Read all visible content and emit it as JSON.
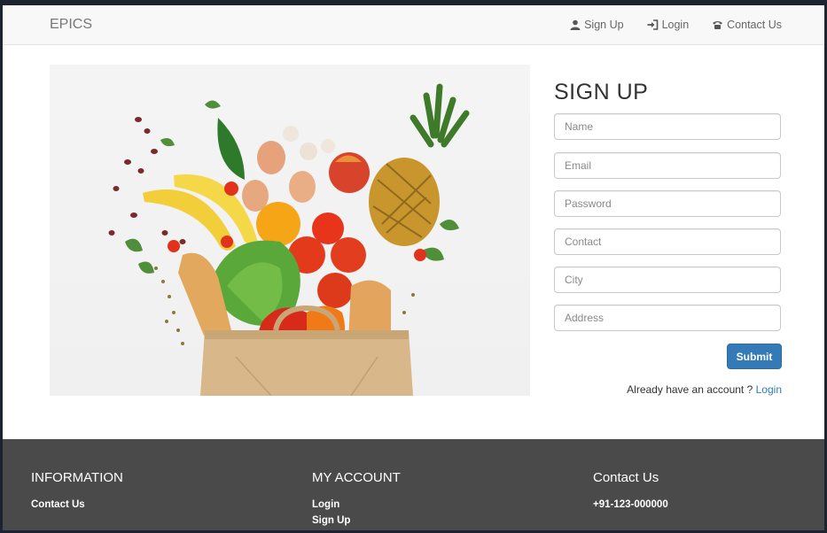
{
  "navbar": {
    "brand": "EPICS",
    "links": [
      {
        "label": "Sign Up",
        "icon": "user-icon"
      },
      {
        "label": "Login",
        "icon": "login-icon"
      },
      {
        "label": "Contact Us",
        "icon": "phone-icon"
      }
    ]
  },
  "hero": {
    "image": "grocery-bag-with-fruits-and-vegetables"
  },
  "form": {
    "title": "SIGN UP",
    "fields": [
      {
        "placeholder": "Name"
      },
      {
        "placeholder": "Email"
      },
      {
        "placeholder": "Password"
      },
      {
        "placeholder": "Contact"
      },
      {
        "placeholder": "City"
      },
      {
        "placeholder": "Address"
      }
    ],
    "submit_label": "Submit",
    "already_text": "Already have an account ?",
    "login_link": "Login"
  },
  "footer": {
    "information": {
      "title": "INFORMATION",
      "links": [
        "Contact Us"
      ]
    },
    "my_account": {
      "title": "MY ACCOUNT",
      "links": [
        "Login",
        "Sign Up"
      ]
    },
    "contact": {
      "title": "Contact Us",
      "phone": "+91-123-000000"
    }
  },
  "colors": {
    "accent": "#337ab7",
    "footer_bg": "#4a4a4a",
    "navbar_bg": "#f8f8f8"
  }
}
